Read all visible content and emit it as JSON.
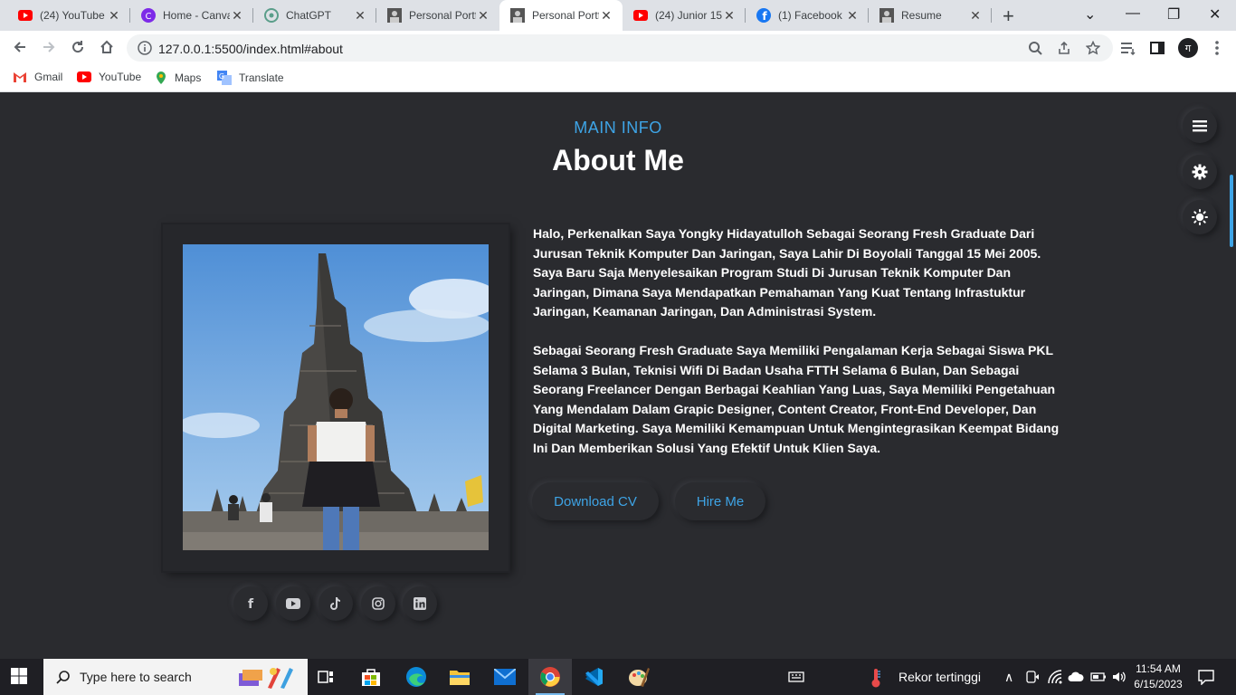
{
  "browser": {
    "tabs": [
      {
        "title": "(24) YouTube",
        "icon": "youtube-icon"
      },
      {
        "title": "Home - Canva",
        "icon": "canva-icon"
      },
      {
        "title": "ChatGPT",
        "icon": "chatgpt-icon"
      },
      {
        "title": "Personal Portfolio",
        "icon": "portfolio-icon"
      },
      {
        "title": "Personal Portfolio",
        "icon": "portfolio-icon",
        "active": true
      },
      {
        "title": "(24) Junior 15",
        "icon": "youtube-icon"
      },
      {
        "title": "(1) Facebook",
        "icon": "facebook-icon"
      },
      {
        "title": "Resume",
        "icon": "resume-icon"
      }
    ],
    "url": "127.0.0.1:5500/index.html#about",
    "bookmarks": [
      {
        "label": "Gmail",
        "icon": "gmail-icon"
      },
      {
        "label": "YouTube",
        "icon": "youtube-icon"
      },
      {
        "label": "Maps",
        "icon": "maps-icon"
      },
      {
        "label": "Translate",
        "icon": "translate-icon"
      }
    ],
    "profile_initial": "ग"
  },
  "section": {
    "subtitle": "MAIN INFO",
    "title": "About Me",
    "paragraphs": [
      "Halo, Perkenalkan Saya Yongky Hidayatulloh Sebagai Seorang Fresh Graduate Dari Jurusan Teknik Komputer Dan Jaringan, Saya Lahir Di Boyolali Tanggal 15 Mei 2005. Saya Baru Saja Menyelesaikan Program Studi Di Jurusan Teknik Komputer Dan Jaringan, Dimana Saya Mendapatkan Pemahaman Yang Kuat Tentang Infrastuktur Jaringan, Keamanan Jaringan, Dan Administrasi System.",
      "Sebagai Seorang Fresh Graduate Saya Memiliki Pengalaman Kerja Sebagai Siswa PKL Selama 3 Bulan, Teknisi Wifi Di Badan Usaha FTTH Selama 6 Bulan, Dan Sebagai Seorang Freelancer Dengan Berbagai Keahlian Yang Luas, Saya Memiliki Pengetahuan Yang Mendalam Dalam Grapic Designer, Content Creator, Front-End Developer, Dan Digital Marketing. Saya Memiliki Kemampuan Untuk Mengintegrasikan Keempat Bidang Ini Dan Memberikan Solusi Yang Efektif Untuk Klien Saya."
    ],
    "buttons": {
      "download": "Download CV",
      "hire": "Hire Me"
    },
    "social": [
      "facebook-icon",
      "youtube-icon",
      "tiktok-icon",
      "instagram-icon",
      "linkedin-icon"
    ],
    "side_buttons": [
      "menu-icon",
      "settings-icon",
      "theme-toggle-icon"
    ]
  },
  "taskbar": {
    "search_placeholder": "Type here to search",
    "weather": "Rekor tertinggi",
    "time": "11:54 AM",
    "date": "6/15/2023"
  },
  "colors": {
    "accent": "#3ea4e6",
    "background": "#2a2b2f",
    "text": "#ffffff"
  }
}
